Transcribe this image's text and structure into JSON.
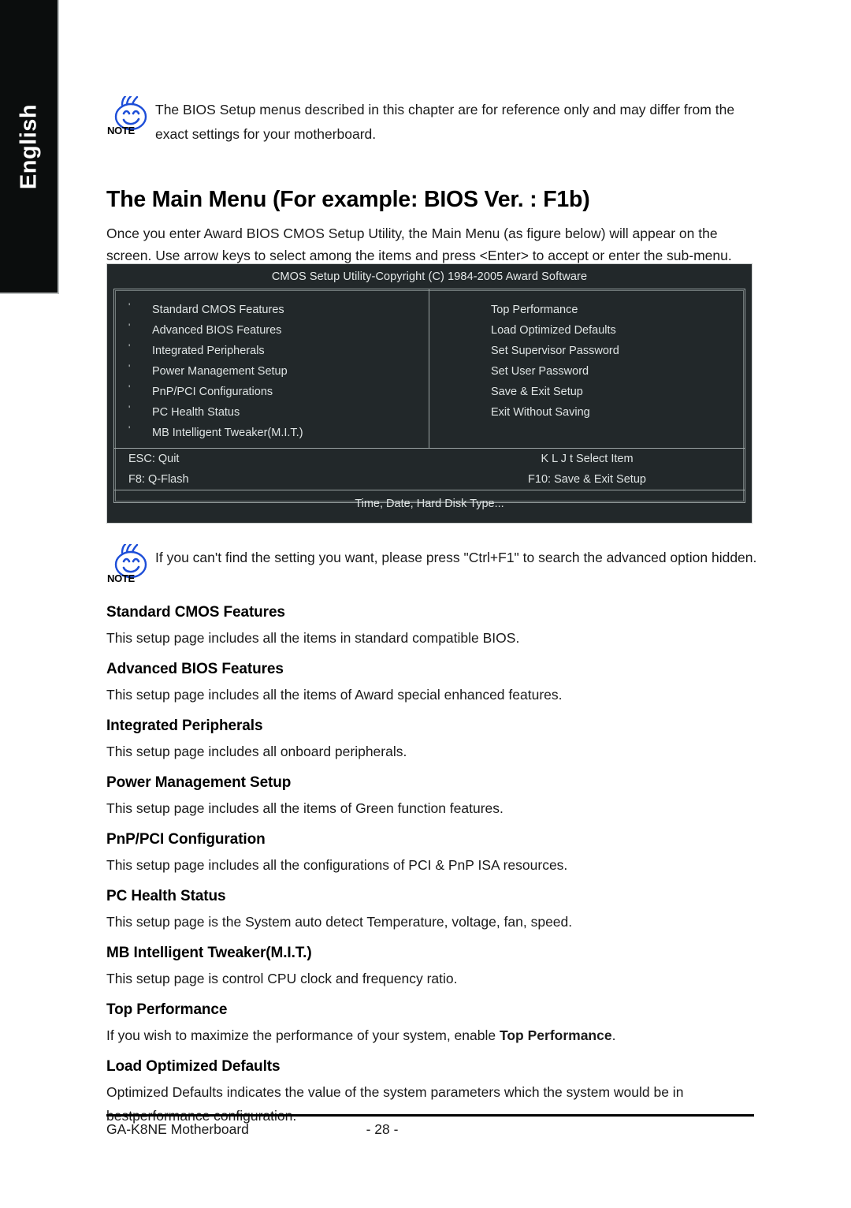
{
  "sidebar": {
    "language_label": "English"
  },
  "notes": {
    "note_word": "NOTE",
    "note1_text": "The BIOS Setup menus described in this chapter are for reference only and may differ from the exact settings for your motherboard.",
    "note2_text": "If you can't find the setting you want, please press \"Ctrl+F1\" to search the advanced option hidden."
  },
  "heading": {
    "title": "The Main Menu (For example: BIOS Ver. : F1b)",
    "intro": "Once you enter Award BIOS CMOS Setup Utility, the Main Menu (as figure below) will appear on the screen. Use arrow keys to select among the items and press <Enter> to accept or enter the sub-menu."
  },
  "bios": {
    "title_bar": "CMOS Setup Utility-Copyright (C) 1984-2005 Award Software",
    "bullet": "'",
    "left_items": [
      "Standard CMOS Features",
      "Advanced BIOS Features",
      "Integrated Peripherals",
      "Power Management Setup",
      "PnP/PCI Configurations",
      "PC Health Status",
      "MB Intelligent Tweaker(M.I.T.)"
    ],
    "right_items": [
      "Top Performance",
      "Load Optimized Defaults",
      "Set Supervisor Password",
      "Set User Password",
      "Save & Exit Setup",
      "Exit Without Saving"
    ],
    "key_rows": [
      {
        "left": "ESC: Quit",
        "right": "K L J t Select Item"
      },
      {
        "left": "F8: Q-Flash",
        "right": "F10: Save & Exit Setup"
      }
    ],
    "status_bar": "Time, Date, Hard Disk Type...",
    "bg_color": "#22282a",
    "text_color": "#dfe4e4",
    "border_color": "#9aa3a3"
  },
  "sections": [
    {
      "heading": "Standard CMOS Features",
      "body": "This setup page includes all the items in standard compatible BIOS."
    },
    {
      "heading": "Advanced BIOS Features",
      "body": "This setup page includes all the items of Award special enhanced features."
    },
    {
      "heading": "Integrated Peripherals",
      "body": "This setup page includes all onboard peripherals."
    },
    {
      "heading": "Power Management Setup",
      "body": "This setup page includes all the items of Green function features."
    },
    {
      "heading": "PnP/PCI Configuration",
      "body": "This setup page includes all the configurations of PCI & PnP ISA resources."
    },
    {
      "heading": "PC Health Status",
      "body": "This setup page is the System auto detect Temperature, voltage, fan, speed."
    },
    {
      "heading": "MB Intelligent Tweaker(M.I.T.)",
      "body": "This setup page is control CPU clock and frequency ratio."
    },
    {
      "heading": "Top Performance",
      "body_pre": "If you wish to maximize the performance of your system, enable ",
      "body_bold": "Top Performance",
      "body_post": "."
    },
    {
      "heading": "Load Optimized Defaults",
      "body": "Optimized Defaults indicates the value of the system parameters which the system would be in bestperformance configuration."
    }
  ],
  "footer": {
    "left": "GA-K8NE Motherboard",
    "page": "- 28 -"
  }
}
